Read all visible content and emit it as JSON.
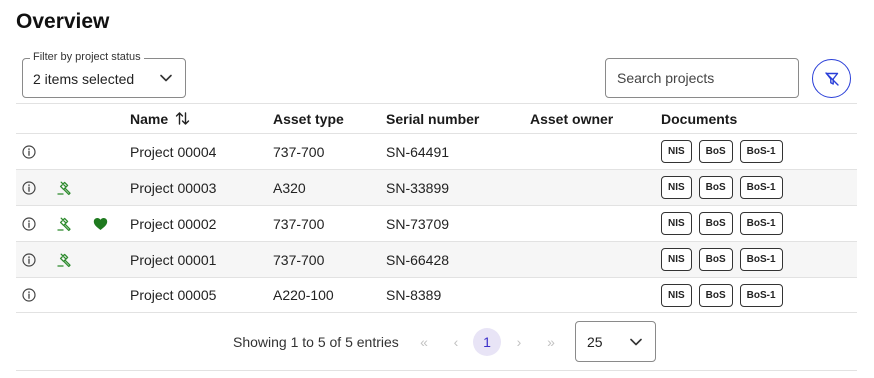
{
  "page": {
    "title": "Overview"
  },
  "filter": {
    "label": "Filter by project status",
    "value": "2 items selected"
  },
  "search": {
    "placeholder": "Search projects"
  },
  "colors": {
    "accent": "#2a3fd8",
    "tool": "#2e8b2e",
    "favorite": "#1f7a1f"
  },
  "table": {
    "columns": [
      "Name",
      "Asset type",
      "Serial number",
      "Asset owner",
      "Documents"
    ],
    "rows": [
      {
        "name": "Project 00004",
        "asset_type": "737-700",
        "serial": "SN-64491",
        "owner": "",
        "tool": false,
        "favorite": false,
        "docs": [
          "NIS",
          "BoS",
          "BoS-1"
        ]
      },
      {
        "name": "Project 00003",
        "asset_type": "A320",
        "serial": "SN-33899",
        "owner": "",
        "tool": true,
        "favorite": false,
        "docs": [
          "NIS",
          "BoS",
          "BoS-1"
        ]
      },
      {
        "name": "Project 00002",
        "asset_type": "737-700",
        "serial": "SN-73709",
        "owner": "",
        "tool": true,
        "favorite": true,
        "docs": [
          "NIS",
          "BoS",
          "BoS-1"
        ]
      },
      {
        "name": "Project 00001",
        "asset_type": "737-700",
        "serial": "SN-66428",
        "owner": "",
        "tool": true,
        "favorite": false,
        "docs": [
          "NIS",
          "BoS",
          "BoS-1"
        ]
      },
      {
        "name": "Project 00005",
        "asset_type": "A220-100",
        "serial": "SN-8389",
        "owner": "",
        "tool": false,
        "favorite": false,
        "docs": [
          "NIS",
          "BoS",
          "BoS-1"
        ]
      }
    ]
  },
  "pagination": {
    "summary": "Showing 1 to 5 of 5 entries",
    "current_page": "1",
    "page_size": "25",
    "first": "«",
    "prev": "‹",
    "next": "›",
    "last": "»"
  }
}
